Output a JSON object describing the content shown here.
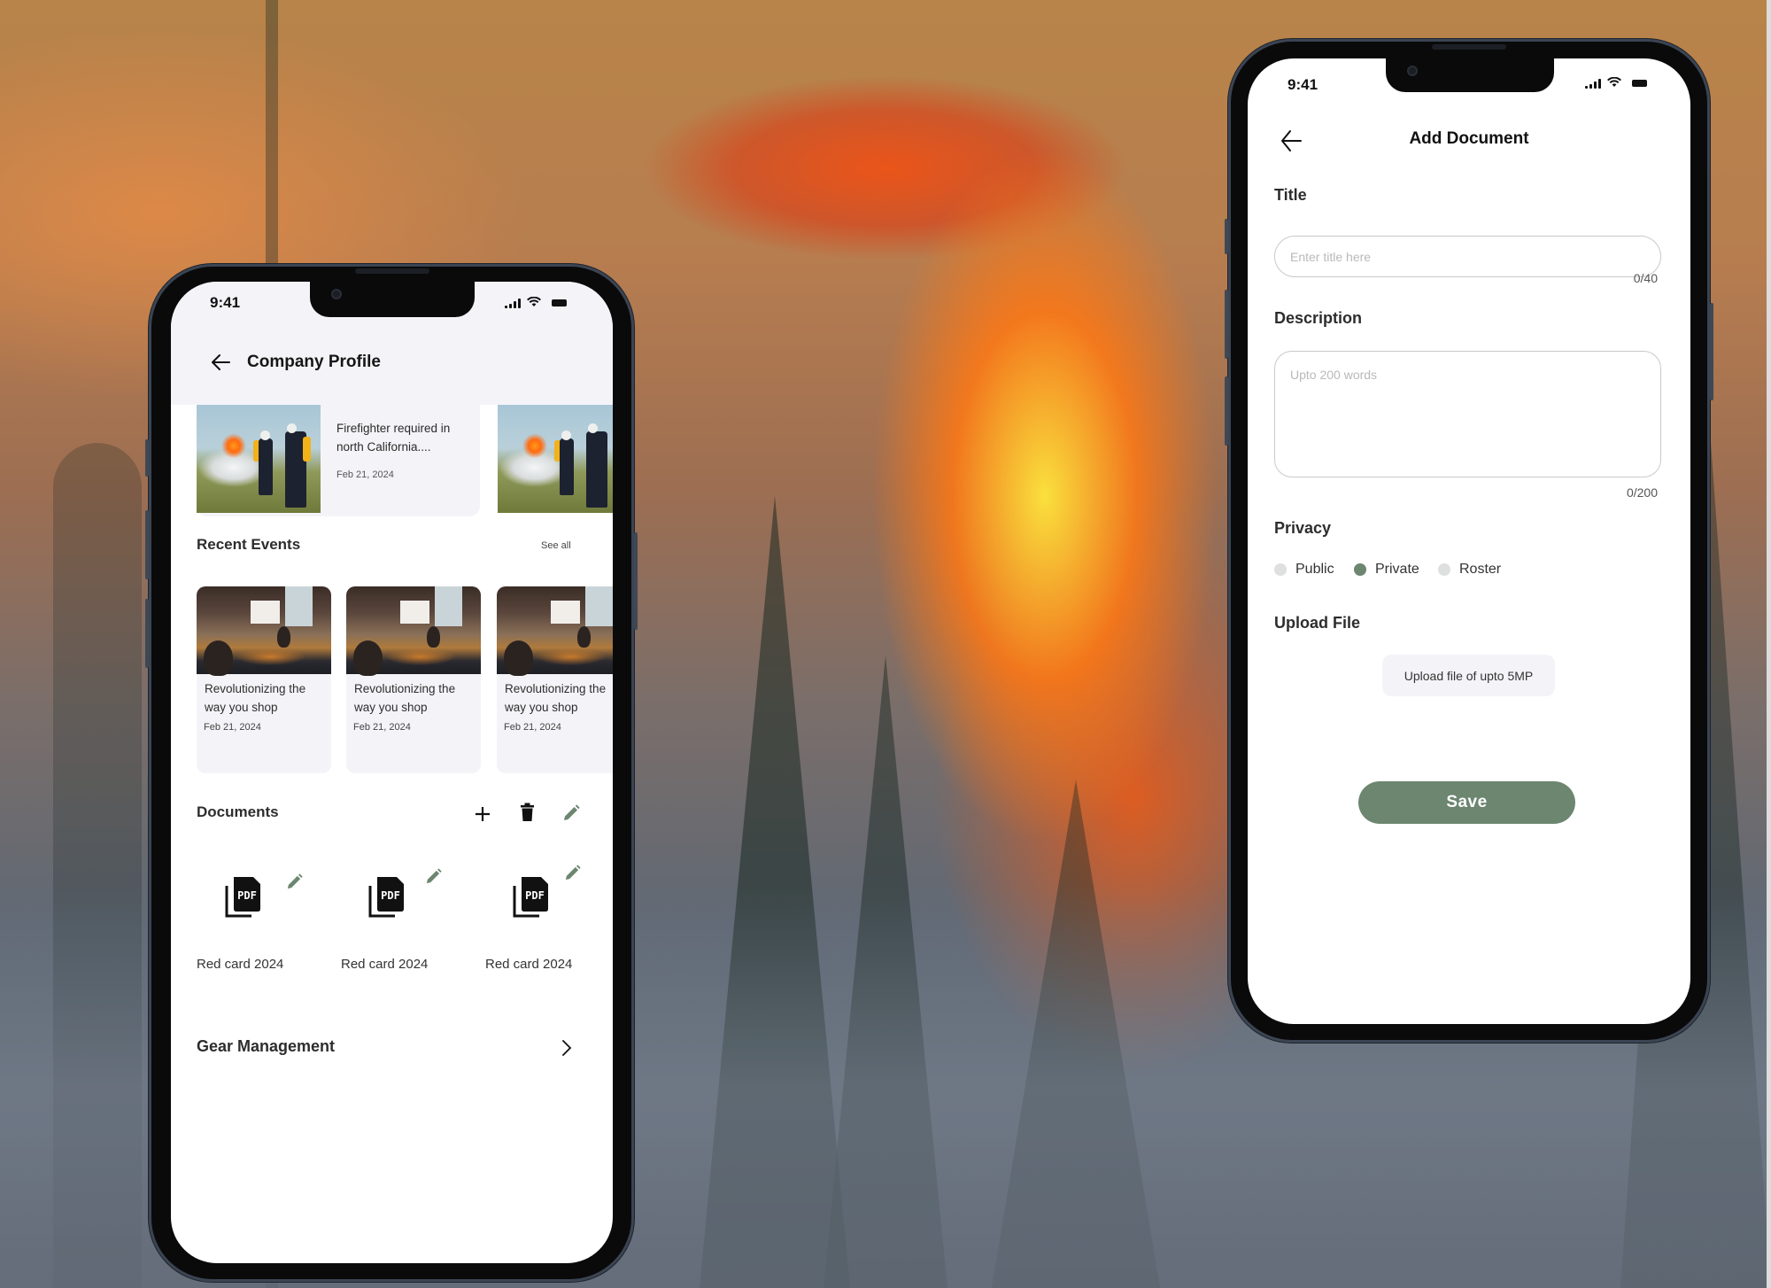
{
  "status_bar": {
    "time": "9:41"
  },
  "company_profile": {
    "title": "Company Profile",
    "job_post": {
      "text_line1": "Firefighter required in",
      "text_line2": "north California....",
      "date": "Feb 21, 2024"
    },
    "recent_events": {
      "title": "Recent Events",
      "see_all_label": "See all",
      "items": [
        {
          "line1": "Revolutionizing the",
          "line2": "way you shop",
          "date": "Feb 21, 2024"
        },
        {
          "line1": "Revolutionizing the",
          "line2": "way you shop",
          "date": "Feb 21, 2024"
        },
        {
          "line1": "Revolutionizing the",
          "line2": "way you shop",
          "date": "Feb 21, 2024"
        }
      ]
    },
    "documents": {
      "title": "Documents",
      "tools": [
        "add",
        "delete",
        "edit"
      ],
      "items": [
        {
          "label": "Red card 2024",
          "type": "PDF"
        },
        {
          "label": "Red card 2024",
          "type": "PDF"
        },
        {
          "label": "Red card 2024",
          "type": "PDF"
        }
      ]
    },
    "gear_management": {
      "title": "Gear Management"
    }
  },
  "add_document": {
    "title": "Add Document",
    "title_field": {
      "label": "Title",
      "value": "",
      "placeholder": "Enter title here",
      "counter": "0/40"
    },
    "description_field": {
      "label": "Description",
      "value": "",
      "placeholder": "Upto 200 words",
      "counter": "0/200"
    },
    "privacy": {
      "label": "Privacy",
      "options": [
        {
          "label": "Public",
          "selected": false
        },
        {
          "label": "Private",
          "selected": true
        },
        {
          "label": "Roster",
          "selected": false
        }
      ]
    },
    "upload": {
      "label": "Upload File",
      "button_label": "Upload file of upto 5MP"
    },
    "save_label": "Save"
  },
  "colors": {
    "accent": "#6c8670",
    "card_bg": "#f4f4f8",
    "radio_off": "#dedfdf"
  }
}
